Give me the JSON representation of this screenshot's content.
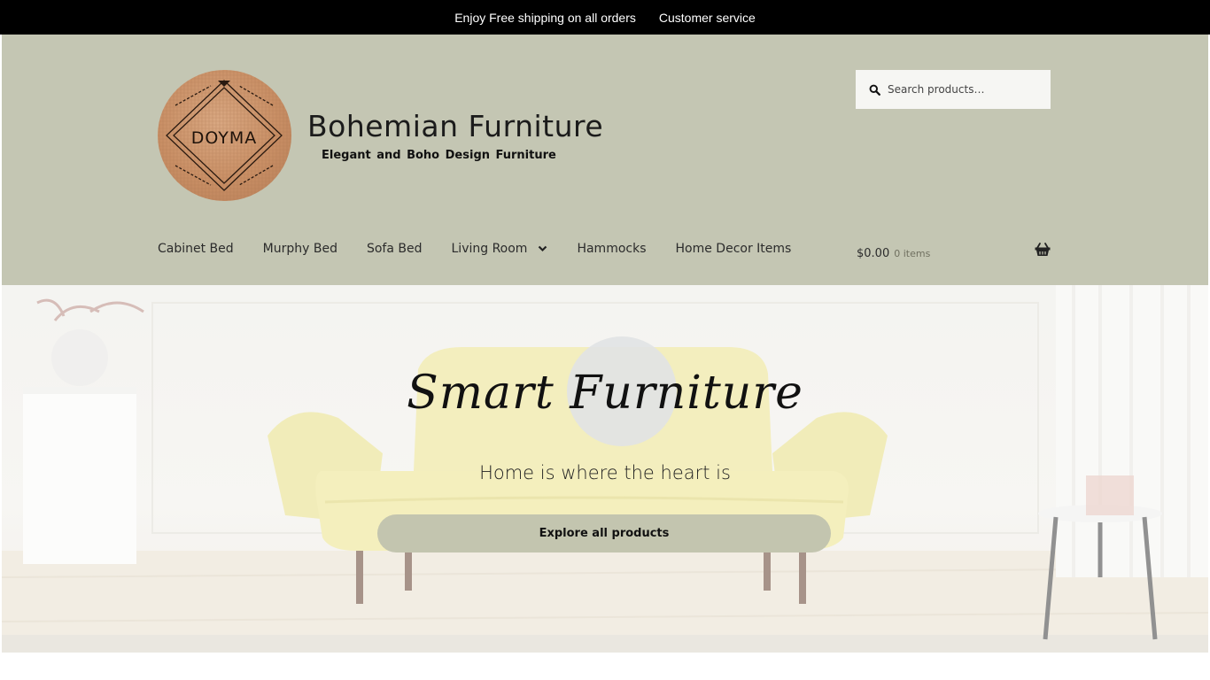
{
  "topbar": {
    "links": [
      "Enjoy Free shipping on all orders",
      "Customer service"
    ]
  },
  "branding": {
    "title": "Bohemian Furniture",
    "tagline": "Elegant and Boho Design Furniture",
    "logo_text": "DOYMA"
  },
  "search": {
    "placeholder": "Search products…",
    "icon": "search-icon"
  },
  "nav": {
    "items": [
      {
        "label": "Cabinet Bed"
      },
      {
        "label": "Murphy Bed"
      },
      {
        "label": "Sofa Bed"
      },
      {
        "label": "Living Room",
        "has_dropdown": true
      },
      {
        "label": "Hammocks"
      },
      {
        "label": "Home Decor Items"
      }
    ]
  },
  "cart": {
    "amount": "$0.00",
    "count": "0 items",
    "icon": "basket-icon"
  },
  "hero": {
    "title": "Smart Furniture",
    "subtitle": "Home is where the heart is",
    "button": "Explore all products"
  },
  "colors": {
    "header_bg": "#c4c6b3",
    "topbar_bg": "#000000",
    "button_bg": "#c3c5af"
  }
}
